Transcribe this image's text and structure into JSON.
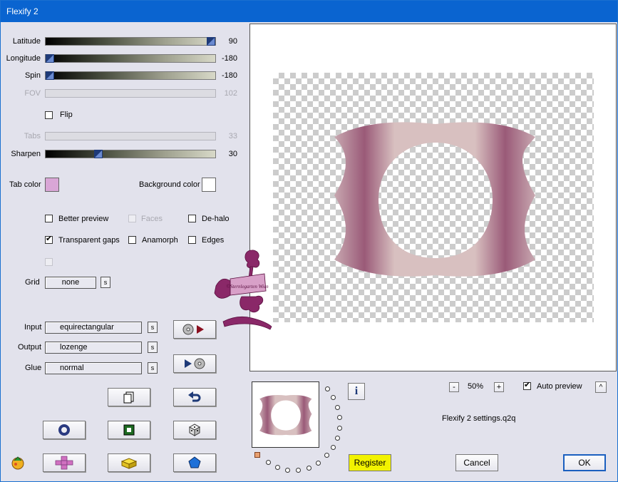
{
  "window": {
    "title": "Flexify 2"
  },
  "sliders": [
    {
      "key": "latitude",
      "label": "Latitude",
      "value": "90",
      "fraction": 1.0,
      "enabled": true
    },
    {
      "key": "longitude",
      "label": "Longitude",
      "value": "-180",
      "fraction": 0.0,
      "enabled": true
    },
    {
      "key": "spin",
      "label": "Spin",
      "value": "-180",
      "fraction": 0.0,
      "enabled": true
    },
    {
      "key": "fov",
      "label": "FOV",
      "value": "102",
      "fraction": null,
      "enabled": false
    },
    {
      "key": "tabs",
      "label": "Tabs",
      "value": "33",
      "fraction": null,
      "enabled": false
    },
    {
      "key": "sharpen",
      "label": "Sharpen",
      "value": "30",
      "fraction": 0.3,
      "enabled": true
    }
  ],
  "flip": {
    "label": "Flip",
    "checked": false
  },
  "colors": {
    "tab_color_label": "Tab color",
    "tab_color": "#d9a6d6",
    "background_color_label": "Background color",
    "background_color": "#ffffff",
    "accent": "#0a64d0",
    "register_bg": "#f2f200"
  },
  "options": {
    "better_preview": {
      "label": "Better preview",
      "checked": false,
      "enabled": true
    },
    "faces": {
      "label": "Faces",
      "checked": false,
      "enabled": false
    },
    "de_halo": {
      "label": "De-halo",
      "checked": false,
      "enabled": true
    },
    "transparent_gaps": {
      "label": "Transparent gaps",
      "checked": true,
      "enabled": true
    },
    "anamorph": {
      "label": "Anamorph",
      "checked": false,
      "enabled": true
    },
    "edges": {
      "label": "Edges",
      "checked": false,
      "enabled": true
    }
  },
  "grid": {
    "label": "Grid",
    "value": "none",
    "s": "s"
  },
  "mapping": {
    "input_label": "Input",
    "input_value": "equirectangular",
    "output_label": "Output",
    "output_value": "lozenge",
    "glue_label": "Glue",
    "glue_value": "normal",
    "s": "s"
  },
  "watermark_text": "©Sternlegarten Wien",
  "zoom": {
    "minus": "-",
    "value": "50%",
    "plus": "+"
  },
  "auto_preview": {
    "label": "Auto preview",
    "checked": true,
    "caret": "^"
  },
  "settings_file": "Flexify 2 settings.q2q",
  "buttons": {
    "register": "Register",
    "cancel": "Cancel",
    "ok": "OK",
    "info": "i"
  },
  "icons": [
    "copy-icon",
    "undo-icon",
    "ring-icon",
    "square-frame-icon",
    "dice-icon",
    "cross-icon",
    "brick-icon",
    "pentagon-icon",
    "disc-play-icon",
    "play-disc-icon",
    "fruit-logo-icon",
    "info-icon"
  ]
}
